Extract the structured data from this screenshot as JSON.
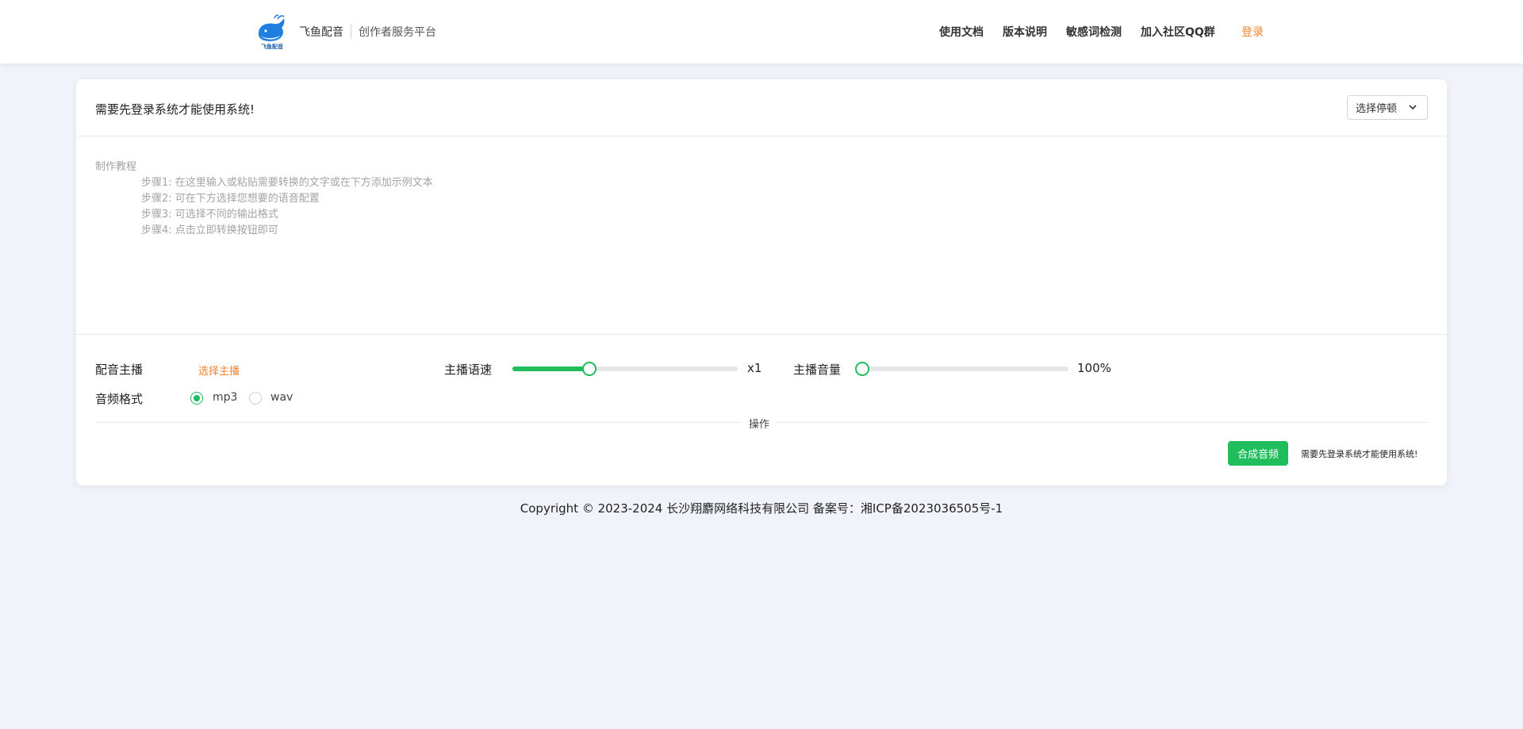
{
  "header": {
    "brand_name": "飞鱼配音",
    "brand_sub": "创作者服务平台",
    "logo_caption": "飞鱼配音",
    "nav": [
      "使用文档",
      "版本说明",
      "敏感词检测",
      "加入社区QQ群"
    ],
    "login_label": "登录"
  },
  "card": {
    "notice": "需要先登录系统才能使用系统!",
    "pause_select": "选择停顿"
  },
  "editor": {
    "placeholder_title": "制作教程",
    "steps": [
      "步骤1: 在这里输入或粘贴需要转换的文字或在下方添加示例文本",
      "步骤2: 可在下方选择您想要的语音配置",
      "步骤3: 可选择不同的输出格式",
      "步骤4: 点击立即转换按钮即可"
    ]
  },
  "controls": {
    "voice_label": "配音主播",
    "voice_pick": "选择主播",
    "speed_label": "主播语速",
    "speed_value": "x1",
    "speed_fraction": 0.34,
    "volume_label": "主播音量",
    "volume_value": "100%",
    "volume_fraction": 0.0,
    "format_label": "音频格式",
    "formats": [
      "mp3",
      "wav"
    ],
    "selected_format": "mp3",
    "divider_label": "操作",
    "synth_button": "合成音频",
    "login_hint": "需要先登录系统才能使用系统!"
  },
  "footer": {
    "copyright": "Copyright © 2023-2024 长沙翔麝网络科技有限公司 备案号：湘ICP备2023036505号-1"
  },
  "colors": {
    "accent_green": "#1fbd5c",
    "accent_orange": "#f0832e",
    "page_bg": "#f0f3f9",
    "logo_blue": "#1f7fe0"
  }
}
